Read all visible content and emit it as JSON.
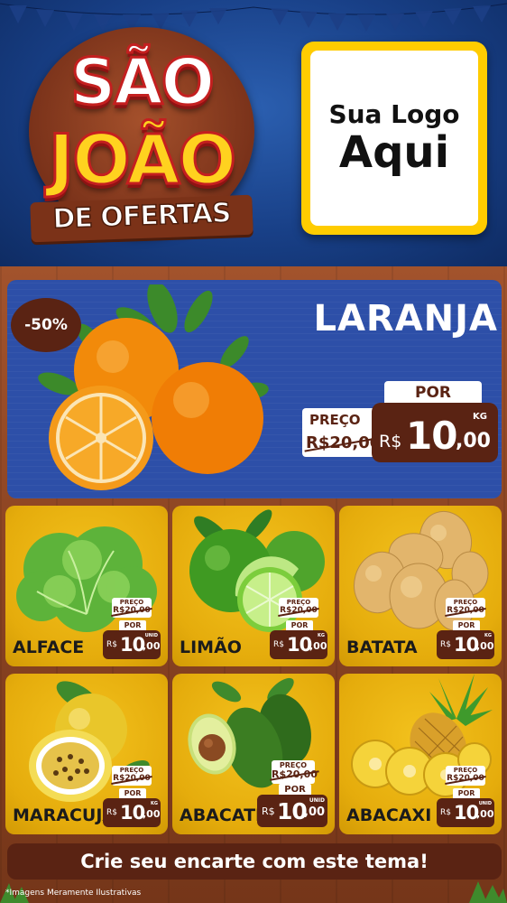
{
  "header": {
    "title_line1": "SÃO",
    "title_line2": "JOÃO",
    "title_line3": "DE OFERTAS",
    "logo_line1": "Sua Logo",
    "logo_line2": "Aqui"
  },
  "featured": {
    "discount": "-50%",
    "name": "LARANJA",
    "preco_label": "PREÇO",
    "old_price": "R$20,00",
    "por_label": "POR",
    "currency": "R$",
    "price_int": "10",
    "price_dec": ",00",
    "unit": "KG"
  },
  "products": [
    {
      "name": "ALFACE",
      "preco_label": "PREÇO",
      "old_price": "R$20,00",
      "por_label": "POR",
      "currency": "R$",
      "price_int": "10",
      "price_dec": ",00",
      "unit": "UNID"
    },
    {
      "name": "LIMÃO",
      "preco_label": "PREÇO",
      "old_price": "R$20,00",
      "por_label": "POR",
      "currency": "R$",
      "price_int": "10",
      "price_dec": ",00",
      "unit": "KG"
    },
    {
      "name": "BATATA",
      "preco_label": "PREÇO",
      "old_price": "R$20,00",
      "por_label": "POR",
      "currency": "R$",
      "price_int": "10",
      "price_dec": ",00",
      "unit": "KG"
    },
    {
      "name": "MARACUJÁ",
      "preco_label": "PREÇO",
      "old_price": "R$20,00",
      "por_label": "POR",
      "currency": "R$",
      "price_int": "10",
      "price_dec": ",00",
      "unit": "KG"
    },
    {
      "name": "ABACATE",
      "preco_label": "PREÇO",
      "old_price": "R$20,00",
      "por_label": "POR",
      "currency": "R$",
      "price_int": "10",
      "price_dec": ",00",
      "unit": "UNID"
    },
    {
      "name": "ABACAXI",
      "preco_label": "PREÇO",
      "old_price": "R$20,00",
      "por_label": "POR",
      "currency": "R$",
      "price_int": "10",
      "price_dec": ",00",
      "unit": "UNID"
    }
  ],
  "footer": {
    "cta": "Crie seu encarte com este tema!",
    "disclaimer": "*Imagens Meramente Ilustrativas"
  },
  "colors": {
    "header_blue": "#183f86",
    "featured_blue": "#2d4fa8",
    "card_yellow": "#f3c21d",
    "price_brown": "#5a2313",
    "logo_yellow": "#ffcc00"
  }
}
